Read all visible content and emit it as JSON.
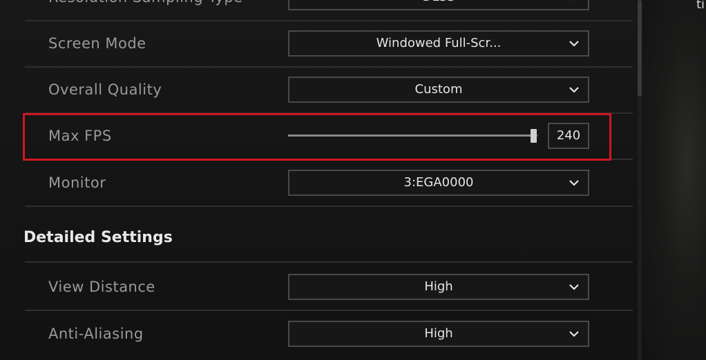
{
  "settings": {
    "rows": [
      {
        "label": "Resolution Sampling Type",
        "value": "DLSS"
      },
      {
        "label": "Screen Mode",
        "value": "Windowed Full-Scr..."
      },
      {
        "label": "Overall Quality",
        "value": "Custom"
      },
      {
        "label": "Max FPS",
        "value": "240",
        "slider_fraction": 0.98
      },
      {
        "label": "Monitor",
        "value": "3:EGA0000"
      }
    ]
  },
  "detailed": {
    "title": "Detailed Settings",
    "rows": [
      {
        "label": "View Distance",
        "value": "High"
      },
      {
        "label": "Anti-Aliasing",
        "value": "High"
      }
    ]
  },
  "icons": {
    "dropdown": "chevron-down-icon",
    "slider": "slider-thumb"
  },
  "colors": {
    "highlight": "#d0161f",
    "text_label": "#9a9a9a",
    "text_value": "#e6e6e6"
  }
}
